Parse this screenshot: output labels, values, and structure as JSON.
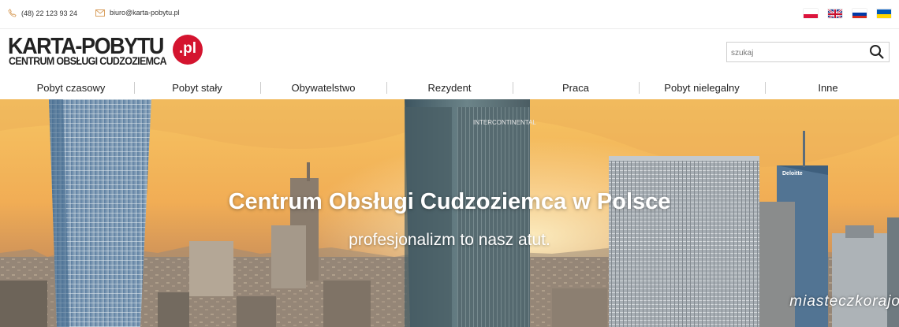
{
  "topbar": {
    "phone": "(48) 22 123 93 24",
    "email": "biuro@karta-pobytu.pl",
    "languages": [
      "polish-flag-icon",
      "english-flag-icon",
      "russian-flag-icon",
      "ukrainian-flag-icon"
    ]
  },
  "logo": {
    "main": "KARTA-POBYTU",
    "sub": "CENTRUM OBSŁUGI CUDZOZIEMCA",
    "badge": ".pl",
    "badge_color": "#d4142f"
  },
  "search": {
    "placeholder": "szukaj"
  },
  "nav": {
    "items": [
      "Pobyt czasowy",
      "Pobyt stały",
      "Obywatelstwo",
      "Rezydent",
      "Praca",
      "Pobyt nielegalny",
      "Inne"
    ]
  },
  "hero": {
    "title": "Centrum Obsługi Cudzoziemca w Polsce",
    "subtitle": "profesjonalizm to nasz atut.",
    "building_signs": [
      "INTERCONTINENTAL",
      "Deloitte"
    ]
  },
  "watermark": "miasteczkorajo"
}
